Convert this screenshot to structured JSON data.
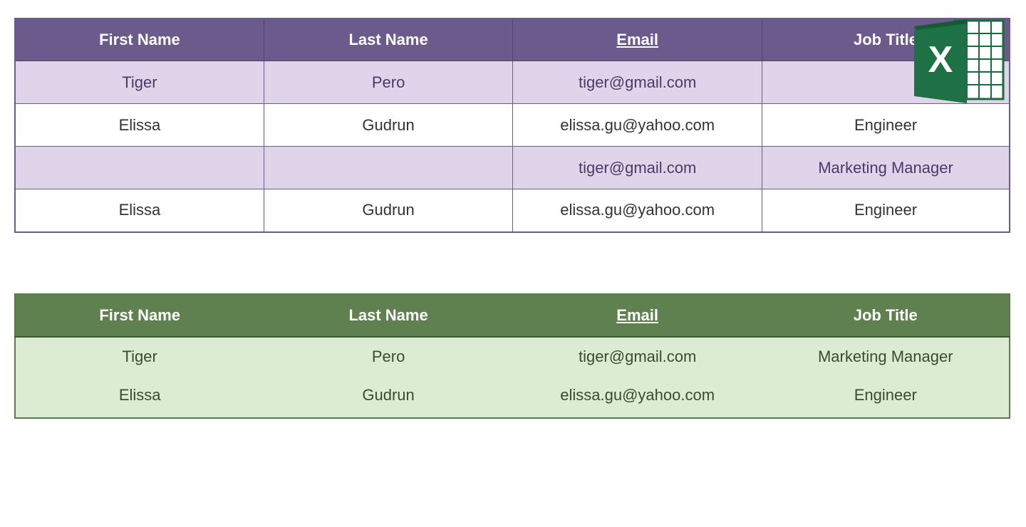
{
  "purple_table": {
    "headers": {
      "first_name": "First Name",
      "last_name": "Last Name",
      "email": "Email",
      "job_title": "Job Title"
    },
    "rows": [
      {
        "first_name": "Tiger",
        "last_name": "Pero",
        "email": "tiger@gmail.com",
        "job_title": ""
      },
      {
        "first_name": "Elissa",
        "last_name": "Gudrun",
        "email": "elissa.gu@yahoo.com",
        "job_title": "Engineer"
      },
      {
        "first_name": "",
        "last_name": "",
        "email": "tiger@gmail.com",
        "job_title": "Marketing Manager"
      },
      {
        "first_name": "Elissa",
        "last_name": "Gudrun",
        "email": "elissa.gu@yahoo.com",
        "job_title": "Engineer"
      }
    ]
  },
  "green_table": {
    "headers": {
      "first_name": "First Name",
      "last_name": "Last Name",
      "email": "Email",
      "job_title": "Job Title"
    },
    "rows": [
      {
        "first_name": "Tiger",
        "last_name": "Pero",
        "email": "tiger@gmail.com",
        "job_title": "Marketing Manager"
      },
      {
        "first_name": "Elissa",
        "last_name": "Gudrun",
        "email": "elissa.gu@yahoo.com",
        "job_title": "Engineer"
      }
    ]
  },
  "icon": {
    "name": "excel-icon",
    "letter": "X"
  }
}
